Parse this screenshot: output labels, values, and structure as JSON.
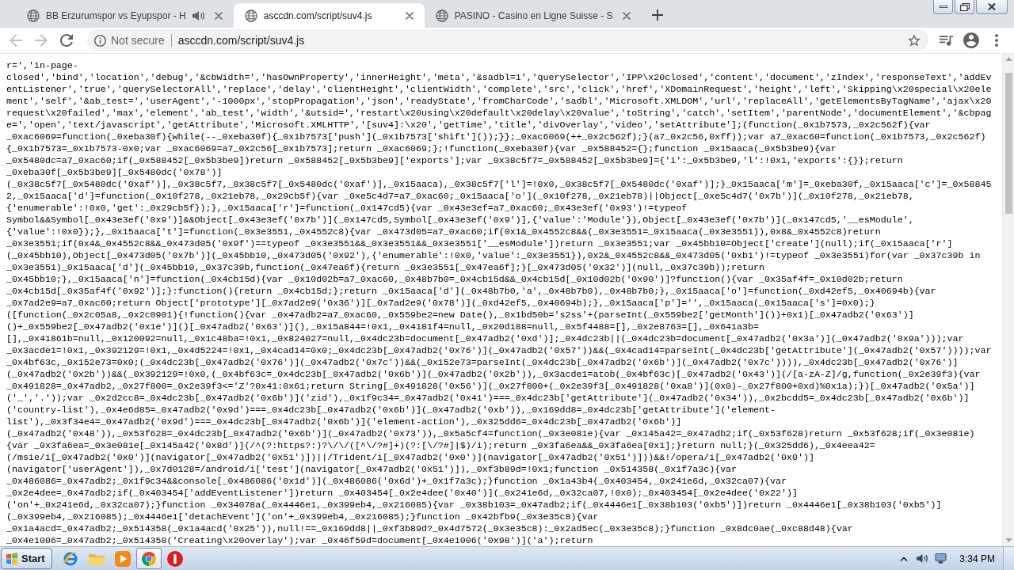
{
  "tabs": [
    {
      "title": "BB Erzurumspor vs Eyupspor - H",
      "selected": false,
      "audio": true
    },
    {
      "title": "asccdn.com/script/suv4.js",
      "selected": true,
      "audio": false
    },
    {
      "title": "PASINO - Casino en Ligne Suisse - S",
      "selected": false,
      "audio": false
    }
  ],
  "toolbar": {
    "nav_buttons": [
      {
        "kind": "back",
        "disabled": true
      },
      {
        "kind": "forward",
        "disabled": true
      },
      {
        "kind": "reload",
        "disabled": false
      }
    ],
    "address_bar": {
      "security_label": "Not secure",
      "url": "asccdn.com/script/suv4.js"
    }
  },
  "document": {
    "lines": [
      "r=','in-page-",
      "closed','bind','location','debug','&cbWidth=','hasOwnProperty','innerHeight','meta','&sadbl=1','querySelector','IPP\\x20closed','content','document','zIndex','responseText','addEv",
      "entListener','true','querySelectorAll','replace','delay','clientHeight','clientWidth','complete','src','click','href','XDomainRequest','height','left','Skipping\\x20special\\x20ele",
      "ment','self','&ab_test=','userAgent','-1000px','stopPropagation','json','readyState','fromCharCode','sadbl','Microsoft.XMLDOM','url','replaceAll','getElementsByTagName','ajax\\x20",
      "request\\x20failed','max','element','ab_test','width','&utsid=','restart\\x20using\\x20default\\x20delay\\x20value','toString','catch','setItem','parentNode','documentElement','&cbpag",
      "e=','open','text/javascript','getAttribute','Microsoft.XMLHTTP','[suv4]:\\x20','getTime','title','divOverlay','video','setAttribute'];(function(_0x1b7573,_0x2c562f){var",
      "_0xac6069=function(_0xeba30f){while(--_0xeba30f){_0x1b7573['push'](_0x1b7573['shift']());}};_0xac6069(++_0x2c562f);}(a7_0x2c56,0xff));var a7_0xac60=function(_0x1b7573,_0x2c562f)",
      "{_0x1b7573=_0x1b7573-0x0;var _0xac6069=a7_0x2c56[_0x1b7573];return _0xac6069;};!function(_0xeba30f){var _0x588452={};function _0x15aaca(_0x5b3be9){var",
      "_0x5480dc=a7_0xac60;if(_0x588452[_0x5b3be9])return _0x588452[_0x5b3be9]['exports'];var _0x38c5f7=_0x588452[_0x5b3be9]={'i':_0x5b3be9,'l':!0x1,'exports':{}};return",
      "_0xeba30f[_0x5b3be9][_0x5480dc('0x78')]",
      "(_0x38c5f7[_0x5480dc('0xaf')],_0x38c5f7,_0x38c5f7[_0x5480dc('0xaf')],_0x15aaca),_0x38c5f7['l']=!0x0,_0x38c5f7[_0x5480dc('0xaf')];}_0x15aaca['m']=_0xeba30f,_0x15aaca['c']=_0x58845",
      "2,_0x15aaca['d']=function(_0x10f278,_0x21eb78,_0x29cb5f){var _0xe5c4d7=a7_0xac60;_0x15aaca['o'](_0x10f278,_0x21eb78)||Object[_0xe5c4d7('0x7b')](_0x10f278,_0x21eb78,",
      "{'enumerable':!0x0,'get':_0x29cb5f});},_0x15aaca['r']=function(_0x147cd5){var _0x43e3ef=a7_0xac60;_0x43e3ef('0x93')!=typeof",
      "Symbol&&Symbol[_0x43e3ef('0x9')]&&Object[_0x43e3ef('0x7b')](_0x147cd5,Symbol[_0x43e3ef('0x9')],{'value':'Module'}),Object[_0x43e3ef('0x7b')](_0x147cd5,'__esModule',",
      "{'value':!0x0});},_0x15aaca['t']=function(_0x3e3551,_0x4552c8){var _0x473d05=a7_0xac60;if(0x1&_0x4552c8&&(_0x3e3551=_0x15aaca(_0x3e3551)),0x8&_0x4552c8)return",
      "_0x3e3551;if(0x4&_0x4552c8&&_0x473d05('0x9f')==typeof _0x3e3551&&_0x3e3551&&_0x3e3551['__esModule'])return _0x3e3551;var _0x45bb10=Object['create'](null);if(_0x15aaca['r']",
      "(_0x45bb10),Object[_0x473d05('0x7b')](_0x45bb10,_0x473d05('0x92'),{'enumerable':!0x0,'value':_0x3e3551}),0x2&_0x4552c8&&_0x473d05('0xb1')!=typeof _0x3e3551)for(var _0x37c39b in",
      "_0x3e3551)_0x15aaca['d'](_0x45bb10,_0x37c39b,function(_0x47ea6f){return _0x3e3551[_0x47ea6f];}[_0x473d05('0x32')](null,_0x37c39b));return",
      "_0x45bb10;},_0x15aaca['n']=function(_0x4cb15d){var _0x10d02b=a7_0xac60,_0x48b7b0=_0x4cb15d&&_0x4cb15d[_0x10d02b('0x90')]?function(){var _0x35af4f=_0x10d02b;return",
      "_0x4cb15d[_0x35af4f('0x92')];}:function(){return _0x4cb15d;};return _0x15aaca['d'](_0x48b7b0,'a',_0x48b7b0),_0x48b7b0;},_0x15aaca['o']=function(_0xd42ef5,_0x40694b){var",
      "_0x7ad2e9=a7_0xac60;return Object['prototype'][_0x7ad2e9('0x36')][_0x7ad2e9('0x78')](_0xd42ef5,_0x40694b);},_0x15aaca['p']='',_0x15aaca(_0x15aaca['s']=0x0);}",
      "([function(_0x2c05a8,_0x2c0901){!function(){var _0x47adb2=a7_0xac60,_0x559be2=new Date(),_0x1bd50b='s2ss'+(parseInt(_0x559be2['getMonth']())+0x1)[_0x47adb2('0x63')]",
      "()+_0x559be2[_0x47adb2('0x1e')]()[_0x47adb2('0x63')](),_0x15a844=!0x1,_0x4181f4=null,_0x20d188=null,_0x5f4488=[],_0x2e8763=[],_0x641a3b=",
      "[],_0x41861b=null,_0x120092=null,_0x1c48ba=!0x1,_0x824027=null,_0x4dc23b=document[_0x47adb2('0xd')];_0x4dc23b||(_0x4dc23b=document[_0x47adb2('0x3a')](_0x47adb2('0x9a')));var",
      "_0x3acde1=!0x1,_0x392129=!0x1,_0x4d5224=!0x1,_0x4cad14=0x0;_0x4dc23b[_0x47adb2('0x76')](_0x47adb2('0x57'))&&(_0x4cad14=parseInt(_0x4dc23b['getAttribute'](_0x47adb2('0x57'))));var",
      "_0x4bf63c,_0x152e73=0x0;(_0x4dc23b[_0x47adb2('0x76')](_0x47adb2('0x7c'))&&(_0x152e73=parseInt(_0x4dc23b[_0x47adb2('0x6b')](_0x47adb2('0x7c')))),_0x4dc23b[_0x47adb2('0x76')]",
      "(_0x47adb2('0x2b'))&&(_0x392129=!0x0,(_0x4bf63c=_0x4dc23b[_0x47adb2('0x6b')](_0x47adb2('0x2b')),_0x3acde1=atob(_0x4bf63c)[_0x47adb2('0x43')](/[a-zA-Z]/g,function(_0x2e39f3){var",
      "_0x491828=_0x47adb2,_0x27f800=_0x2e39f3<='Z'?0x41:0x61;return String[_0x491828('0x56')](_0x27f800+(_0x2e39f3[_0x491828('0xa8')](0x0)-_0x27f800+0xd)%0x1a);})[_0x47adb2('0x5a')]",
      "('_','.'));var _0x2d2cc8=_0x4dc23b[_0x47adb2('0x6b')]('zid'),_0x1f9c34=_0x47adb2('0x41')===_0x4dc23b['getAttribute'](_0x47adb2('0x34')),_0x2bcdd5=_0x4dc23b[_0x47adb2('0x6b')]",
      "('country-list'),_0x4e6d85=_0x47adb2('0x9d')===_0x4dc23b[_0x47adb2('0x6b')](_0x47adb2('0xb')),_0x169dd8=_0x4dc23b['getAttribute']('element-",
      "list'),_0x3f34e4=_0x47adb2('0x9d')===_0x4dc23b[_0x47adb2('0x6b')]('element-action'),_0x325dd6=_0x4dc23b[_0x47adb2('0x6b')]",
      "(_0x47adb2('0x48')),_0x53f628=_0x4dc23b[_0x47adb2('0x6b')](_0x47adb2('0x73')),_0x5a5cf4=function(_0x3e081e){var _0x145a42=_0x47adb2;if(_0x53f628)return _0x53f628;if(_0x3e081e)",
      "{var _0x3fa6ea=_0x3e081e[_0x145a42('0x8d')](/^(?:https?:)?\\/\\/([^\\/?#]+)(?:[\\/?#]|$)/i);return _0x3fa6ea&&_0x3fa6ea[0x1];}return null;}(_0x325dd6),_0x4eea42=",
      "(/msie/i[_0x47adb2('0x0')](navigator[_0x47adb2('0x51')])||/Trident/i[_0x47adb2('0x0')](navigator[_0x47adb2('0x51')]))&&!/opera/i[_0x47adb2('0x0')]",
      "(navigator['userAgent']),_0x7d0128=/android/i['test'](navigator[_0x47adb2('0x51')]),_0xf3b89d=!0x1;function _0x514358(_0x1f7a3c){var",
      "_0x486086=_0x47adb2;_0x1f9c34&&console[_0x486086('0x1d')](_0x486086('0x6d')+_0x1f7a3c);}function _0x1a43b4(_0x403454,_0x241e6d,_0x32ca07){var",
      "_0x2e4dee=_0x47adb2;if(_0x403454['addEventListener'])return _0x403454[_0x2e4dee('0x40')](_0x241e6d,_0x32ca07,!0x0);_0x403454[_0x2e4dee('0x22')]",
      "('on'+_0x241e6d,_0x32ca07);}function _0x34078a(_0x4446e1,_0x399eb4,_0x216085){var _0x38b103=_0x47adb2;if(_0x4446e1[_0x38b103('0xb5')])return _0x4446e1[_0x38b103('0xb5')]",
      "(_0x399eb4,_0x216085);_0x4446e1['detachEvent']('on'+_0x399eb4,_0x216085);}function _0x42bfb9(_0x3e35c8){var",
      "_0x1a4acd=_0x47adb2;_0x514358(_0x1a4acd('0x25')),null!==_0x169dd8||_0xf3b89d?_0x4d7572(_0x3e35c8):_0x2ad5ec(_0x3e35c8);}function _0x8dc0ae(_0xc88d48){var",
      "_0x4e1006=_0x47adb2;_0x514358('Creating\\x20overlay');var _0x46f59d=document[_0x4e1006('0x98')]('a');return"
    ]
  },
  "taskbar": {
    "start_label": "Start",
    "apps": [
      {
        "kind": "internet-explorer",
        "selected": false
      },
      {
        "kind": "folder",
        "selected": false
      },
      {
        "kind": "media-player",
        "selected": false
      },
      {
        "kind": "chrome",
        "selected": true
      },
      {
        "kind": "warning",
        "selected": false
      }
    ],
    "clock": "3:34 PM"
  }
}
